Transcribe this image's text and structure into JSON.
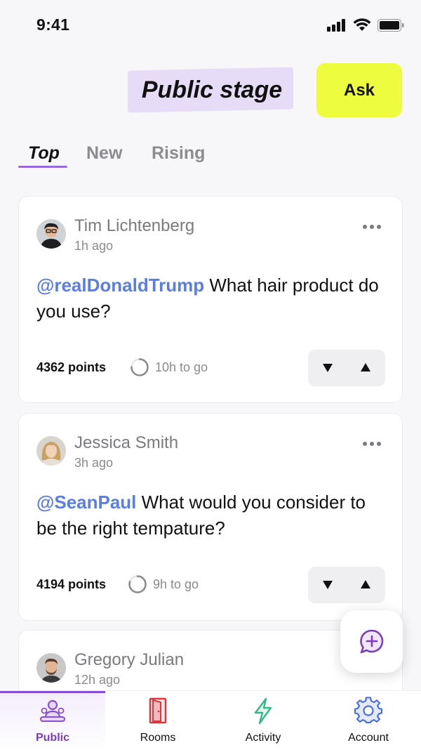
{
  "status_bar": {
    "time": "9:41"
  },
  "header": {
    "title": "Public stage",
    "ask_label": "Ask"
  },
  "tabs": [
    {
      "label": "Top",
      "active": true
    },
    {
      "label": "New",
      "active": false
    },
    {
      "label": "Rising",
      "active": false
    }
  ],
  "posts": [
    {
      "author": "Tim Lichtenberg",
      "time": "1h ago",
      "mention": "@realDonaldTrump",
      "question": " What hair product do you use?",
      "points": "4362 points",
      "time_left": "10h to go",
      "timer_progress": 0.75
    },
    {
      "author": "Jessica Smith",
      "time": "3h ago",
      "mention": "@SeanPaul",
      "question": " What would you consider to be the right tempature?",
      "points": "4194 points",
      "time_left": "9h to go",
      "timer_progress": 0.8
    },
    {
      "author": "Gregory Julian",
      "time": "12h ago"
    }
  ],
  "bottom_nav": [
    {
      "label": "Public",
      "icon": "people-icon",
      "active": true
    },
    {
      "label": "Rooms",
      "icon": "door-icon",
      "active": false
    },
    {
      "label": "Activity",
      "icon": "lightning-icon",
      "active": false
    },
    {
      "label": "Account",
      "icon": "gear-icon",
      "active": false
    }
  ],
  "colors": {
    "accent_purple": "#8a4fcf",
    "ask_yellow": "#eefc3f",
    "mention_blue": "#5b7fe0",
    "rooms_red": "#d9363e",
    "activity_green": "#34b58a",
    "account_blue": "#4a6fd8"
  }
}
